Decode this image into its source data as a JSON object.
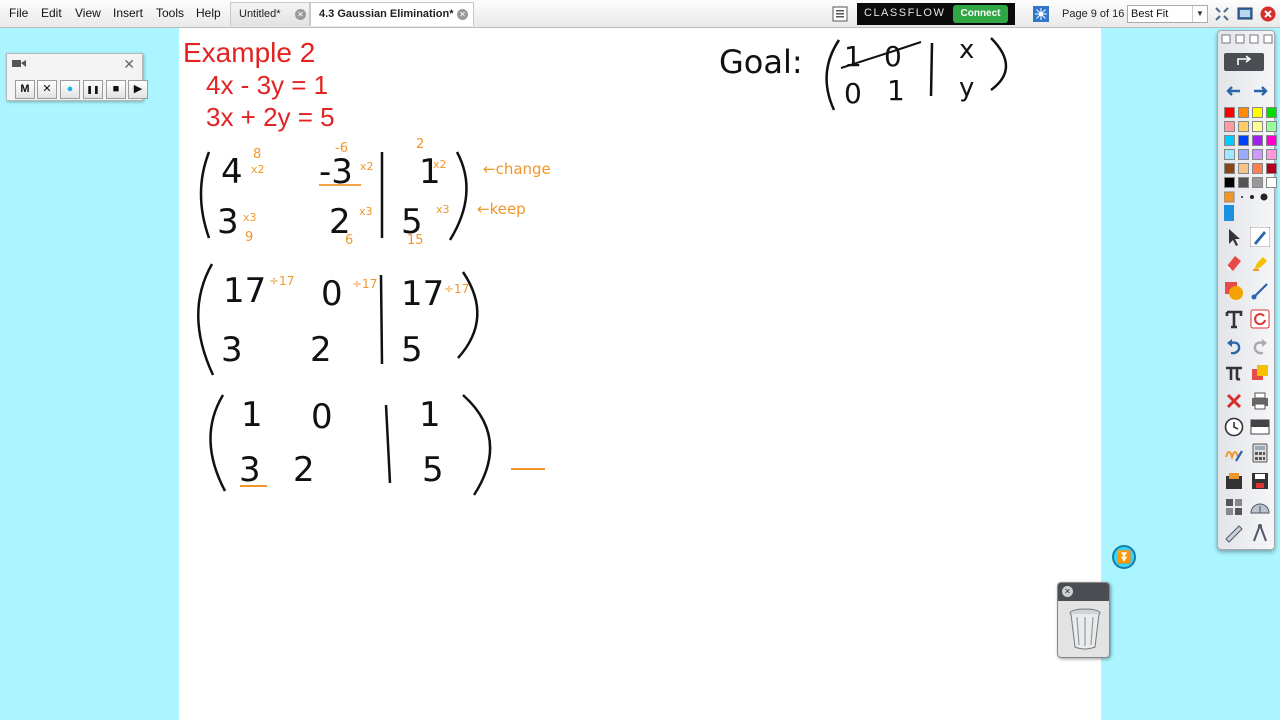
{
  "menu": [
    "File",
    "Edit",
    "View",
    "Insert",
    "Tools",
    "Help"
  ],
  "tabs": [
    {
      "label": "Untitled*",
      "active": false
    },
    {
      "label": "4.3 Gaussian Elimination*",
      "active": true
    }
  ],
  "classflow": {
    "brand": "CLASSFLOW",
    "connect_label": "Connect"
  },
  "page_indicator": "Page 9 of 16",
  "zoom": {
    "selected": "Best Fit"
  },
  "recorder": {
    "buttons": [
      "M",
      "✕",
      "●",
      "❚❚",
      "■",
      "▶"
    ]
  },
  "lesson": {
    "title": "Example 2",
    "equations": [
      "4x - 3y = 1",
      "3x + 2y = 5"
    ]
  },
  "annotations": {
    "goal": "Goal:",
    "change": "←change",
    "keep": "←keep"
  },
  "matrices": {
    "m1": {
      "r1": [
        "4",
        "-3",
        "1"
      ],
      "r2": [
        "3",
        "2",
        "5"
      ],
      "mult_r1": [
        "x2",
        "x2",
        "x2"
      ],
      "mult_r2": [
        "x3",
        "x3",
        "x3"
      ],
      "prod_r1": [
        "8",
        "-6",
        "2"
      ],
      "prod_r2": [
        "9",
        "6",
        "15"
      ]
    },
    "m2": {
      "r1": [
        "17",
        "0",
        "17"
      ],
      "r2": [
        "3",
        "2",
        "5"
      ],
      "div": [
        "÷17",
        "÷17",
        "÷17"
      ]
    },
    "m3": {
      "r1": [
        "1",
        "0",
        "1"
      ],
      "r2": [
        "3",
        "2",
        "5"
      ]
    },
    "goal": {
      "r1": [
        "1",
        "0",
        "x"
      ],
      "r2": [
        "0",
        "1",
        "y"
      ]
    }
  },
  "colors": {
    "printed_text": "#e32222",
    "ink_black": "#111111",
    "ink_orange": "#f0962a",
    "canvas_bg": "#aaf5ff",
    "page_bg": "#ffffff",
    "classflow_bg": "#0b0b0b",
    "connect_green": "#2fa744"
  },
  "palette": [
    "#ff0000",
    "#ff8c00",
    "#ffff00",
    "#00e000",
    "#ff9aa2",
    "#ffcc66",
    "#ffff99",
    "#99ff99",
    "#00ccff",
    "#0040ff",
    "#a020f0",
    "#ff00cc",
    "#a0e8ff",
    "#99aaff",
    "#cc99ff",
    "#ff99dd",
    "#8b4513",
    "#f5c48a",
    "#ff7f50",
    "#b00020",
    "#000000",
    "#555555",
    "#999999",
    "#ffffff"
  ],
  "icons": {
    "top": [
      "menu-icon",
      "network-icon",
      "fit-width-icon",
      "monitor-icon",
      "close-window-icon"
    ],
    "tools": [
      "select-arrow-icon",
      "pen-icon",
      "eraser-icon",
      "highlighter-icon",
      "shape-icon",
      "connector-icon",
      "text-icon",
      "refresh-icon",
      "undo-icon",
      "redo-icon",
      "pi-icon",
      "stamp-icon",
      "delete-icon",
      "print-icon",
      "clock-icon",
      "screen-shade-icon",
      "handwriting-icon",
      "calculator-icon",
      "library-icon",
      "save-icon",
      "grid-icon",
      "protractor-icon",
      "ruler-icon",
      "compass-icon"
    ]
  }
}
